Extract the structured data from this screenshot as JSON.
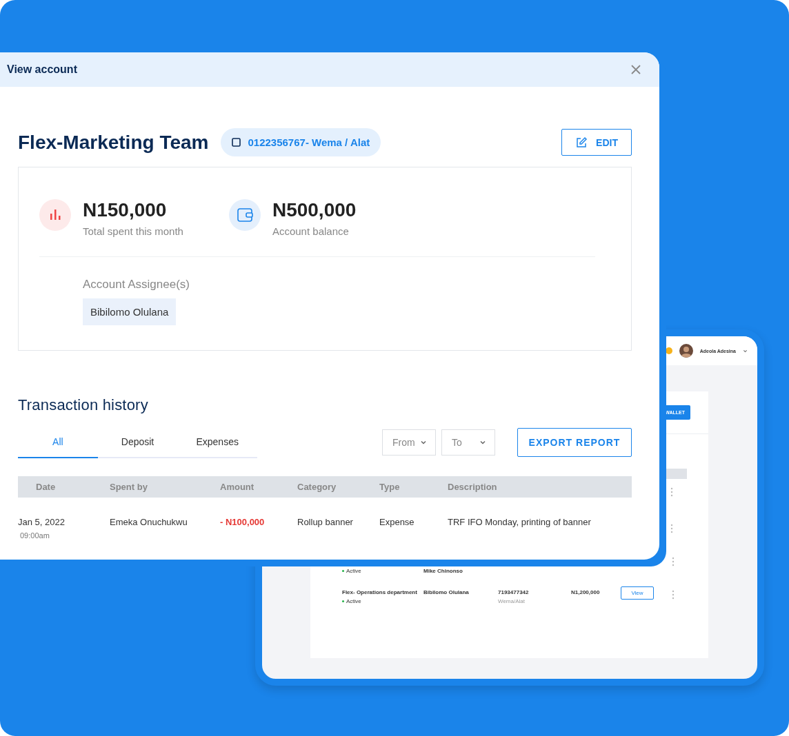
{
  "back_window": {
    "user": {
      "name": "Adeola Adesina",
      "has_notification": true
    },
    "wallet_button": "WALLET",
    "rows": [
      {
        "status": "Active",
        "assignee": "Mike Chinonso"
      },
      {
        "name": "Flex- Operations department",
        "status": "Active",
        "assignee": "Bibilomo Olulana",
        "account": "7193477342",
        "bank": "Wema/Alat",
        "balance": "N1,200,000",
        "action": "View"
      }
    ]
  },
  "modal": {
    "title": "View account",
    "account_name": "Flex-Marketing Team",
    "account_pill": "0122356767- Wema / Alat",
    "edit_button": "EDIT",
    "stats": [
      {
        "kind": "spent",
        "value": "N150,000",
        "label": "Total spent this month"
      },
      {
        "kind": "balance",
        "value": "N500,000",
        "label": "Account balance"
      }
    ],
    "assignees_label": "Account Assignee(s)",
    "assignees": [
      "Bibilomo Olulana"
    ],
    "history_title": "Transaction history",
    "tabs": [
      {
        "label": "All",
        "selected": true
      },
      {
        "label": "Deposit",
        "selected": false
      },
      {
        "label": "Expenses",
        "selected": false
      }
    ],
    "filters": [
      {
        "label": "From"
      },
      {
        "label": "To"
      }
    ],
    "export_button": "EXPORT REPORT",
    "table": {
      "columns": [
        "Date",
        "Spent by",
        "Amount",
        "Category",
        "Type",
        "Description"
      ],
      "rows": [
        {
          "date": "Jan 5, 2022",
          "time": "09:00am",
          "spent_by": "Emeka Onuchukwu",
          "amount": "- N100,000",
          "amount_negative": true,
          "category": "Rollup banner",
          "type": "Expense",
          "description": "TRF IFO Monday, printing of banner"
        }
      ]
    }
  }
}
